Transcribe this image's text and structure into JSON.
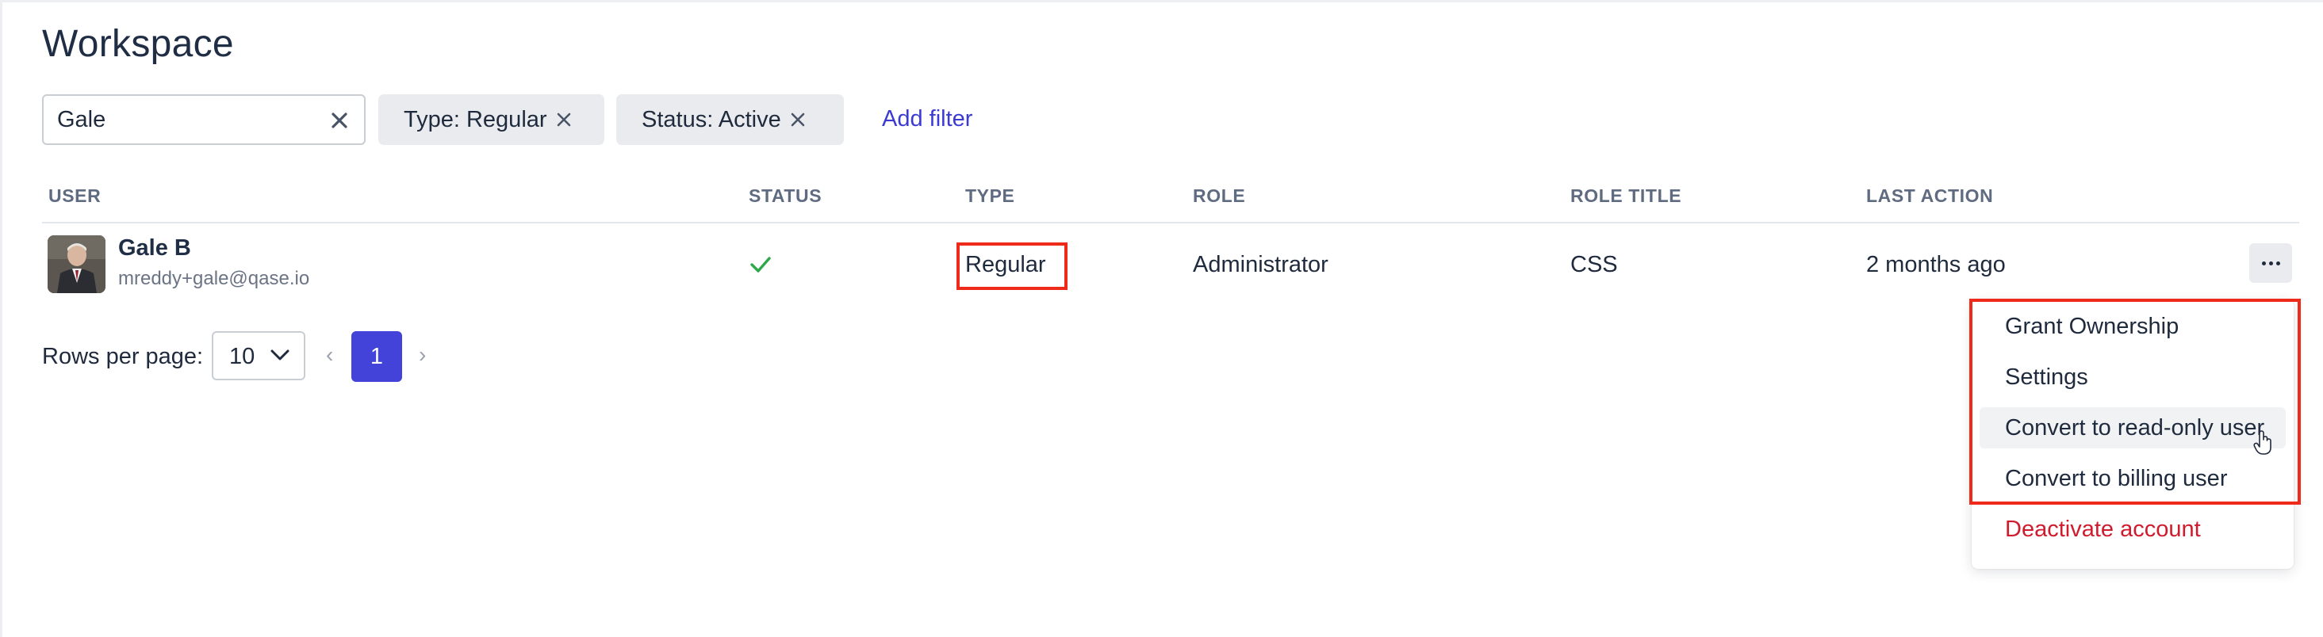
{
  "page": {
    "title": "Workspace"
  },
  "filters": {
    "search_value": "Gale",
    "chips": [
      {
        "label": "Type: Regular"
      },
      {
        "label": "Status: Active"
      }
    ],
    "add_filter_label": "Add filter"
  },
  "table": {
    "headers": {
      "user": "USER",
      "status": "STATUS",
      "type": "TYPE",
      "role": "ROLE",
      "role_title": "ROLE TITLE",
      "last_action": "LAST ACTION"
    },
    "rows": [
      {
        "name": "Gale B",
        "email": "mreddy+gale@qase.io",
        "status_icon": "check-icon",
        "type": "Regular",
        "role": "Administrator",
        "role_title": "CSS",
        "last_action": "2 months ago"
      }
    ]
  },
  "pagination": {
    "rows_per_page_label": "Rows per page:",
    "rows_per_page_value": "10",
    "prev_symbol": "‹",
    "next_symbol": "›",
    "current_page": "1"
  },
  "row_menu": {
    "items": [
      {
        "label": "Grant Ownership"
      },
      {
        "label": "Settings"
      },
      {
        "label": "Convert to read-only user"
      },
      {
        "label": "Convert to billing user"
      },
      {
        "label": "Deactivate account"
      }
    ]
  },
  "colors": {
    "accent": "#4343d9",
    "link": "#3b3bd4",
    "success": "#2ea84a",
    "danger": "#cf1b2d",
    "highlight": "#ee2b1b"
  }
}
